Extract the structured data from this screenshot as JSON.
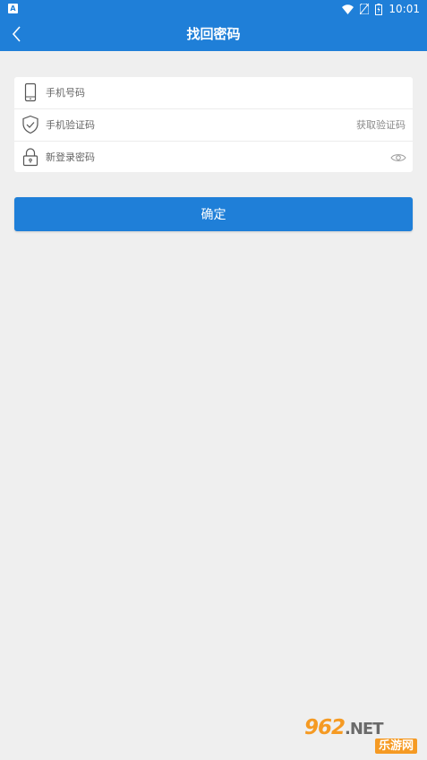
{
  "status_bar": {
    "notification_badge": "A",
    "time": "10:01",
    "icons": [
      "wifi-icon",
      "no-sim-icon",
      "battery-icon"
    ]
  },
  "nav": {
    "title": "找回密码",
    "back_icon": "chevron-left-icon"
  },
  "form": {
    "phone": {
      "placeholder": "手机号码",
      "icon": "phone-icon"
    },
    "sms_code": {
      "placeholder": "手机验证码",
      "icon": "shield-check-icon",
      "action_label": "获取验证码"
    },
    "new_password": {
      "placeholder": "新登录密码",
      "icon": "lock-icon",
      "toggle_icon": "eye-icon"
    }
  },
  "confirm_button": {
    "label": "确定"
  },
  "watermark": {
    "top": "962",
    "top_suffix": ".NET",
    "bottom": "乐游网"
  },
  "colors": {
    "primary": "#1f7fd8",
    "background": "#efefef",
    "accent": "#f59a23"
  }
}
